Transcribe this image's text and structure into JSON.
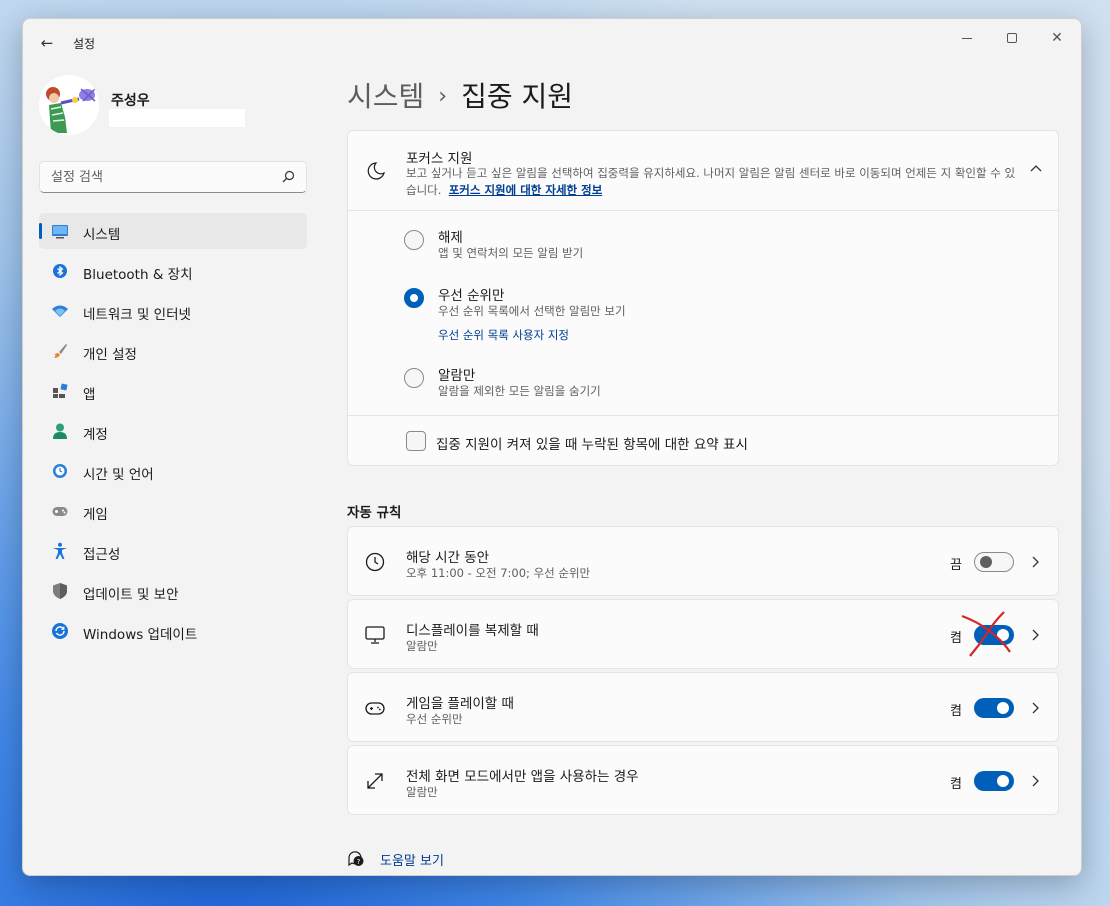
{
  "window": {
    "title": "설정"
  },
  "user": {
    "name": "주성우"
  },
  "search": {
    "placeholder": "설정 검색"
  },
  "sidebar": {
    "items": [
      {
        "label": "시스템",
        "icon": "system-monitor-icon"
      },
      {
        "label": "Bluetooth & 장치",
        "icon": "bluetooth-icon"
      },
      {
        "label": "네트워크 및 인터넷",
        "icon": "wifi-icon"
      },
      {
        "label": "개인 설정",
        "icon": "brush-icon"
      },
      {
        "label": "앱",
        "icon": "apps-icon"
      },
      {
        "label": "계정",
        "icon": "account-icon"
      },
      {
        "label": "시간 및 언어",
        "icon": "clock-globe-icon"
      },
      {
        "label": "게임",
        "icon": "gamepad-icon"
      },
      {
        "label": "접근성",
        "icon": "accessibility-icon"
      },
      {
        "label": "업데이트 및 보안",
        "icon": "shield-icon"
      },
      {
        "label": "Windows 업데이트",
        "icon": "windows-update-icon"
      }
    ]
  },
  "breadcrumb": {
    "parent": "시스템",
    "separator": "›",
    "current": "집중 지원"
  },
  "focus": {
    "title": "포커스 지원",
    "description": "보고 싶거나 듣고 싶은 알림을 선택하여 집중력을 유지하세요. 나머지 알림은 알림 센터로 바로 이동되며 언제든 지 확인할 수 있습니다.",
    "link": "포커스 지원에 대한 자세한 정보",
    "options": [
      {
        "label": "해제",
        "desc": "앱 및 연락처의 모든 알림 받기",
        "checked": false
      },
      {
        "label": "우선 순위만",
        "desc": "우선 순위 목록에서 선택한 알림만 보기",
        "link": "우선 순위 목록 사용자 지정",
        "checked": true
      },
      {
        "label": "알람만",
        "desc": "알람을 제외한 모든 알림을 숨기기",
        "checked": false
      }
    ],
    "summary_checkbox": "집중 지원이 켜져 있을 때 누락된 항목에 대한 요약 표시"
  },
  "rules": {
    "title": "자동 규칙",
    "items": [
      {
        "title": "해당 시간 동안",
        "desc": "오후 11:00 - 오전 7:00; 우선 순위만",
        "state": "끔",
        "on": false,
        "icon": "clock-icon"
      },
      {
        "title": "디스플레이를 복제할 때",
        "desc": "알람만",
        "state": "켬",
        "on": true,
        "icon": "monitor-icon"
      },
      {
        "title": "게임을 플레이할 때",
        "desc": "우선 순위만",
        "state": "켬",
        "on": true,
        "icon": "game-controller-icon"
      },
      {
        "title": "전체 화면 모드에서만 앱을 사용하는 경우",
        "desc": "알람만",
        "state": "켬",
        "on": true,
        "icon": "fullscreen-arrows-icon"
      }
    ]
  },
  "help": {
    "label": "도움말 보기"
  },
  "colors": {
    "accent": "#005fb8",
    "link": "#003e92",
    "annotation": "#d4252b"
  }
}
